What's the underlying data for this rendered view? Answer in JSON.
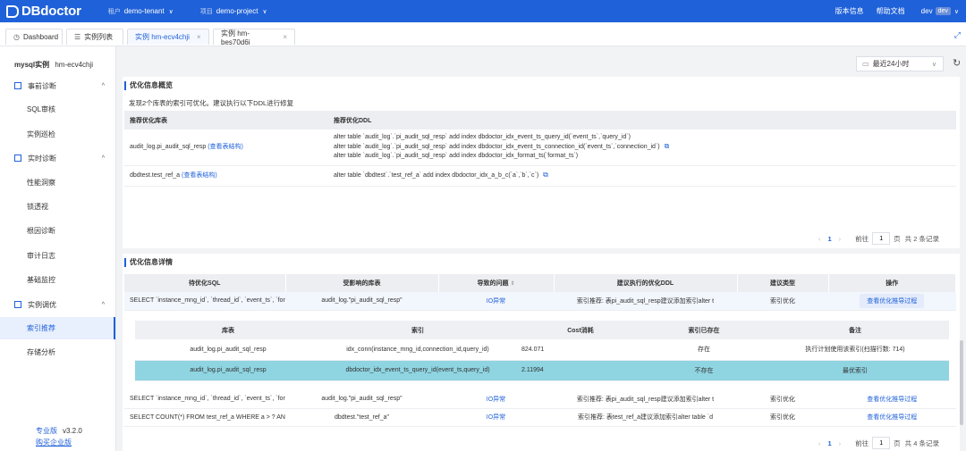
{
  "topbar": {
    "brand": "DBdoctor",
    "tenant_key": "租户",
    "tenant_value": "demo-tenant",
    "project_key": "项目",
    "project_value": "demo-project",
    "version_info": "版本信息",
    "help_docs": "帮助文档",
    "user": "dev",
    "user_badge": "dev",
    "accent_color": "#1f61d9"
  },
  "tabs": [
    {
      "label": "Dashboard",
      "icon": "dashboard-icon"
    },
    {
      "label": "实例列表",
      "icon": "list-icon"
    },
    {
      "label": "实例 hm-ecv4chji",
      "active": true
    },
    {
      "label": "实例 hm-bes70d6i"
    }
  ],
  "sidebar": {
    "instance_type": "mysql实例",
    "instance_id": "hm-ecv4chji",
    "groups": [
      {
        "label": "事前诊断",
        "items": [
          "SQL审核",
          "实例巡检"
        ]
      },
      {
        "label": "实时诊断",
        "items": [
          "性能洞察",
          "锁透视",
          "根因诊断",
          "审计日志",
          "基础监控"
        ]
      },
      {
        "label": "实例调优",
        "items": [
          "索引推荐",
          "存储分析"
        ]
      }
    ],
    "active_item": "索引推荐",
    "edition": "专业版",
    "version": "v3.2.0",
    "buy_link": "购买企业版"
  },
  "toolbar": {
    "time_range": "最近24小时"
  },
  "overview": {
    "title": "优化信息概览",
    "hint": "发现2个库表的索引可优化。建议执行以下DDL进行修复",
    "columns": [
      "推荐优化库表",
      "推荐优化DDL"
    ],
    "rows": [
      {
        "table": "audit_log.pi_audit_sql_resp",
        "link": "(查看表结构)",
        "ddl": [
          "alter table `audit_log`.`pi_audit_sql_resp` add index dbdoctor_idx_event_ts_query_id(`event_ts`,`query_id`)",
          "alter table `audit_log`.`pi_audit_sql_resp` add index dbdoctor_idx_event_ts_connection_id(`event_ts`,`connection_id`)",
          "alter table `audit_log`.`pi_audit_sql_resp` add index dbdoctor_idx_format_ts(`format_ts`)"
        ]
      },
      {
        "table": "dbdtest.test_ref_a",
        "link": "(查看表结构)",
        "ddl": [
          "alter table `dbdtest`.`test_ref_a` add index dbdoctor_idx_a_b_c(`a`,`b`,`c`)"
        ]
      }
    ],
    "pager": {
      "page": "1",
      "goto_label": "前往",
      "goto_value": "1",
      "page_unit": "页",
      "total": "共 2 条记录"
    }
  },
  "details": {
    "title": "优化信息详情",
    "columns": [
      "待优化SQL",
      "受影响的库表",
      "导致的问题",
      "建议执行的优化DDL",
      "建议类型",
      "操作"
    ],
    "rows": [
      {
        "sql": "SELECT `instance_mng_id`, `thread_id`, `event_ts`, `format_",
        "table": "audit_log.\"pi_audit_sql_resp\"",
        "issue": "IO异常",
        "ddl": "索引推荐: 表pi_audit_sql_resp建议添加索引alter t",
        "type": "索引优化",
        "action": "查看优化推导过程"
      },
      {
        "sql": "SELECT `instance_mng_id`, `thread_id`, `event_ts`, `format_",
        "table": "audit_log.\"pi_audit_sql_resp\"",
        "issue": "IO异常",
        "ddl": "索引推荐: 表pi_audit_sql_resp建议添加索引alter t",
        "type": "索引优化",
        "action": "查看优化推导过程"
      },
      {
        "sql": "SELECT COUNT(*) FROM test_ref_a WHERE a > ? AND a <",
        "table": "dbdtest.\"test_ref_a\"",
        "issue": "IO异常",
        "ddl": "索引推荐: 表test_ref_a建议添加索引alter table `d",
        "type": "索引优化",
        "action": "查看优化推导过程"
      }
    ],
    "nested": {
      "columns": [
        "库表",
        "索引",
        "Cost消耗",
        "索引已存在",
        "备注"
      ],
      "rows": [
        {
          "table": "audit_log.pi_audit_sql_resp",
          "index": "idx_conn(instance_mng_id,connection_id,query_id)",
          "cost": "824.071",
          "exists": "存在",
          "note": "执行计划使用该索引(扫描行数: 714)"
        },
        {
          "table": "audit_log.pi_audit_sql_resp",
          "index": "dbdoctor_idx_event_ts_query_id(event_ts,query_id)",
          "cost": "2.11994",
          "exists": "不存在",
          "note": "最优索引",
          "best": true
        }
      ]
    },
    "pager": {
      "page": "1",
      "goto_label": "前往",
      "goto_value": "1",
      "page_unit": "页",
      "total": "共 4 条记录"
    }
  }
}
